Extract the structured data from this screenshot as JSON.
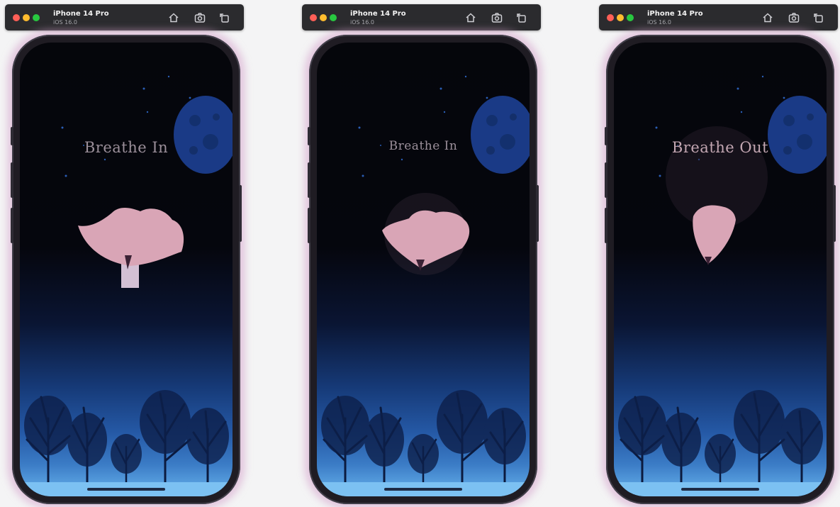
{
  "simulators": [
    {
      "device_name": "iPhone 14 Pro",
      "os_version": "iOS 16.0",
      "caption": "Breathe In"
    },
    {
      "device_name": "iPhone 14 Pro",
      "os_version": "iOS 16.0",
      "caption": "Breathe In"
    },
    {
      "device_name": "iPhone 14 Pro",
      "os_version": "iOS 16.0",
      "caption": "Breathe Out"
    }
  ],
  "toolbar_icons": [
    "home-icon",
    "screenshot-icon",
    "rotate-icon"
  ],
  "colors": {
    "petal": "#d9a5b6",
    "night_sky": "#05060b",
    "snow": "#6ab5ee"
  }
}
